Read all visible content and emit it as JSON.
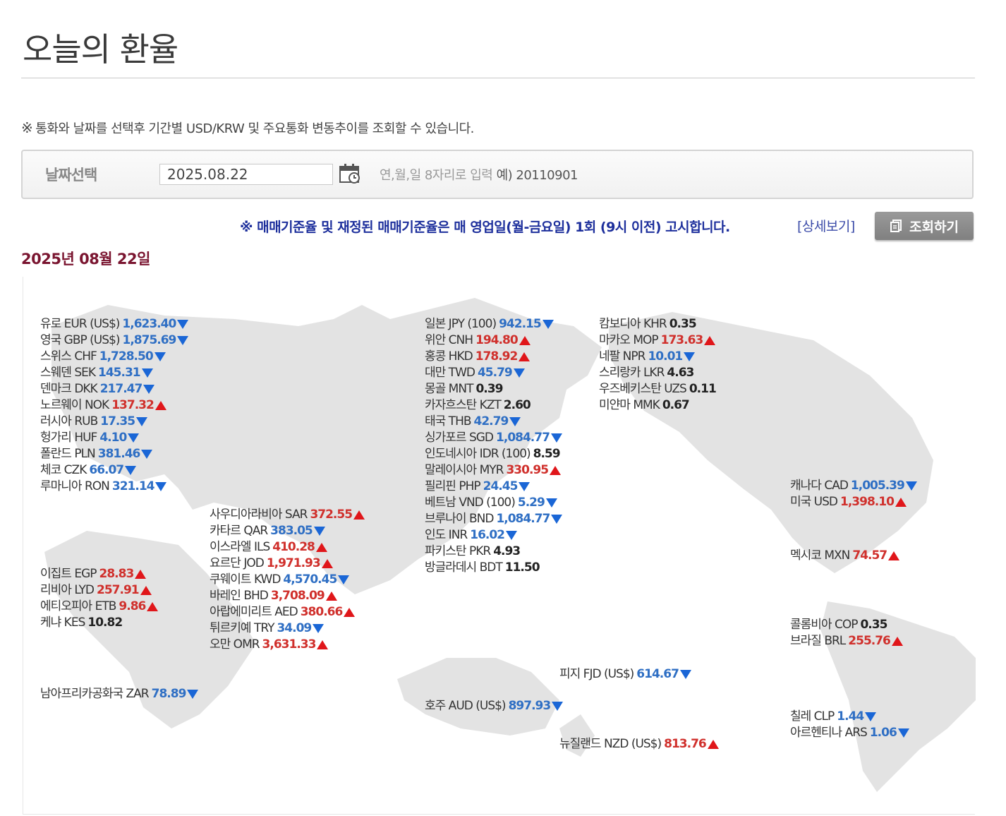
{
  "page": {
    "title": "오늘의 환율",
    "notice": "통화와 날짜를 선택후 기간별 USD/KRW 및 주요통화 변동추이를 조회할 수 있습니다.",
    "notice_mark": "※"
  },
  "search": {
    "date_label": "날짜선택",
    "date_value": "2025.08.22",
    "hint": "연,월,일 8자리로 입력",
    "example": "예) 20110901",
    "calendar_icon": "calendar-icon",
    "blue_notice": "※ 매매기준율 및 재정된 매매기준율은 매 영업일(월-금요일) 1회 (9시 이전) 고시합니다.",
    "detail_link": "[상세보기]",
    "search_button": "조회하기",
    "search_button_icon": "document-icon"
  },
  "date_heading": "2025년 08월 22일",
  "colors": {
    "up": "#d0302c",
    "down": "#2f6fc4",
    "heading": "#7a1530",
    "notice_blue": "#1d2f9c"
  },
  "groups": {
    "europe": [
      {
        "name": "유로 EUR (US$)",
        "value": "1,623.40",
        "trend": "down"
      },
      {
        "name": "영국 GBP (US$)",
        "value": "1,875.69",
        "trend": "down"
      },
      {
        "name": "스위스 CHF",
        "value": "1,728.50",
        "trend": "down"
      },
      {
        "name": "스웨덴 SEK",
        "value": "145.31",
        "trend": "down"
      },
      {
        "name": "덴마크 DKK",
        "value": "217.47",
        "trend": "down"
      },
      {
        "name": "노르웨이 NOK",
        "value": "137.32",
        "trend": "up"
      },
      {
        "name": "러시아 RUB",
        "value": "17.35",
        "trend": "down"
      },
      {
        "name": "헝가리 HUF",
        "value": "4.10",
        "trend": "down"
      },
      {
        "name": "폴란드 PLN",
        "value": "381.46",
        "trend": "down"
      },
      {
        "name": "체코 CZK",
        "value": "66.07",
        "trend": "down"
      },
      {
        "name": "루마니아 RON",
        "value": "321.14",
        "trend": "down"
      }
    ],
    "middle_east": [
      {
        "name": "사우디아라비아 SAR",
        "value": "372.55",
        "trend": "up"
      },
      {
        "name": "카타르 QAR",
        "value": "383.05",
        "trend": "down"
      },
      {
        "name": "이스라엘 ILS",
        "value": "410.28",
        "trend": "up"
      },
      {
        "name": "요르단 JOD",
        "value": "1,971.93",
        "trend": "up"
      },
      {
        "name": "쿠웨이트 KWD",
        "value": "4,570.45",
        "trend": "down"
      },
      {
        "name": "바레인 BHD",
        "value": "3,708.09",
        "trend": "up"
      },
      {
        "name": "아랍에미리트 AED",
        "value": "380.66",
        "trend": "up"
      },
      {
        "name": "튀르키예 TRY",
        "value": "34.09",
        "trend": "down"
      },
      {
        "name": "오만 OMR",
        "value": "3,631.33",
        "trend": "up"
      }
    ],
    "africa": [
      {
        "name": "이집트 EGP",
        "value": "28.83",
        "trend": "up"
      },
      {
        "name": "리비아 LYD",
        "value": "257.91",
        "trend": "up"
      },
      {
        "name": "에티오피아 ETB",
        "value": "9.86",
        "trend": "up"
      },
      {
        "name": "케냐 KES",
        "value": "10.82",
        "trend": "flat"
      }
    ],
    "south_africa": [
      {
        "name": "남아프리카공화국 ZAR",
        "value": "78.89",
        "trend": "down"
      }
    ],
    "east_asia": [
      {
        "name": "일본 JPY (100)",
        "value": "942.15",
        "trend": "down"
      },
      {
        "name": "위안 CNH",
        "value": "194.80",
        "trend": "up"
      },
      {
        "name": "홍콩 HKD",
        "value": "178.92",
        "trend": "up"
      },
      {
        "name": "대만 TWD",
        "value": "45.79",
        "trend": "down"
      },
      {
        "name": "몽골 MNT",
        "value": "0.39",
        "trend": "flat"
      },
      {
        "name": "카자흐스탄 KZT",
        "value": "2.60",
        "trend": "flat"
      },
      {
        "name": "태국 THB",
        "value": "42.79",
        "trend": "down"
      },
      {
        "name": "싱가포르 SGD",
        "value": "1,084.77",
        "trend": "down"
      },
      {
        "name": "인도네시아 IDR (100)",
        "value": "8.59",
        "trend": "flat"
      },
      {
        "name": "말레이시아 MYR",
        "value": "330.95",
        "trend": "up"
      },
      {
        "name": "필리핀 PHP",
        "value": "24.45",
        "trend": "down"
      },
      {
        "name": "베트남 VND (100)",
        "value": "5.29",
        "trend": "down"
      },
      {
        "name": "브루나이 BND",
        "value": "1,084.77",
        "trend": "down"
      },
      {
        "name": "인도 INR",
        "value": "16.02",
        "trend": "down"
      },
      {
        "name": "파키스탄 PKR",
        "value": "4.93",
        "trend": "flat"
      },
      {
        "name": "방글라데시 BDT",
        "value": "11.50",
        "trend": "flat"
      }
    ],
    "southeast_asia": [
      {
        "name": "캄보디아 KHR",
        "value": "0.35",
        "trend": "flat"
      },
      {
        "name": "마카오 MOP",
        "value": "173.63",
        "trend": "up"
      },
      {
        "name": "네팔 NPR",
        "value": "10.01",
        "trend": "down"
      },
      {
        "name": "스리랑카 LKR",
        "value": "4.63",
        "trend": "flat"
      },
      {
        "name": "우즈베키스탄 UZS",
        "value": "0.11",
        "trend": "flat"
      },
      {
        "name": "미얀마 MMK",
        "value": "0.67",
        "trend": "flat"
      }
    ],
    "north_america": [
      {
        "name": "캐나다 CAD",
        "value": "1,005.39",
        "trend": "down"
      },
      {
        "name": "미국 USD",
        "value": "1,398.10",
        "trend": "up"
      }
    ],
    "mexico": [
      {
        "name": "멕시코 MXN",
        "value": "74.57",
        "trend": "up"
      }
    ],
    "south_america": [
      {
        "name": "콜롬비아 COP",
        "value": "0.35",
        "trend": "flat"
      },
      {
        "name": "브라질 BRL",
        "value": "255.76",
        "trend": "up"
      }
    ],
    "fiji": [
      {
        "name": "피지 FJD (US$)",
        "value": "614.67",
        "trend": "down"
      }
    ],
    "australia": [
      {
        "name": "호주 AUD (US$)",
        "value": "897.93",
        "trend": "down"
      }
    ],
    "southern_cone": [
      {
        "name": "칠레 CLP",
        "value": "1.44",
        "trend": "down"
      },
      {
        "name": "아르헨티나 ARS",
        "value": "1.06",
        "trend": "down"
      }
    ],
    "new_zealand": [
      {
        "name": "뉴질랜드 NZD (US$)",
        "value": "813.76",
        "trend": "up"
      }
    ]
  }
}
